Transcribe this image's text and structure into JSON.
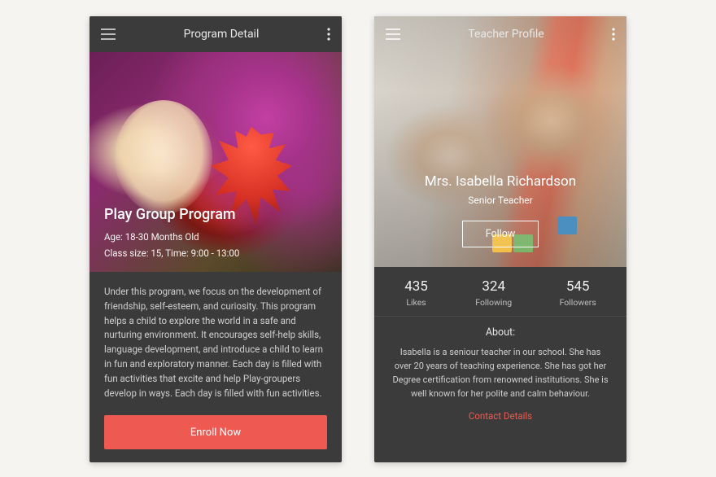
{
  "colors": {
    "card_bg": "#3b3b3b",
    "accent": "#ee5a52",
    "text_light": "#cfcfcf"
  },
  "screen1": {
    "appbar": {
      "title": "Program Detail"
    },
    "hero": {
      "title": "Play Group Program",
      "age_line": "Age: 18-30 Months Old",
      "class_line": "Class size: 15, Time: 9:00 - 13:00"
    },
    "body": "Under this program, we focus on the development of friendship, self-esteem, and curiosity. This program helps a child to explore the world in a safe and nurturing environment. It encourages self-help skills, language development, and introduce a child to learn in fun and exploratory manner. Each day is filled with fun activities that excite and help Play-groupers develop in ways. Each day is filled with fun activities.",
    "cta": "Enroll Now"
  },
  "screen2": {
    "appbar": {
      "title": "Teacher Profile"
    },
    "hero": {
      "name": "Mrs. Isabella Richardson",
      "role": "Senior Teacher",
      "follow": "Follow"
    },
    "stats": [
      {
        "num": "435",
        "label": "Likes"
      },
      {
        "num": "324",
        "label": "Following"
      },
      {
        "num": "545",
        "label": "Followers"
      }
    ],
    "about": {
      "heading": "About:",
      "text": "Isabella is a seniour teacher in our school. She has over 20 years of teaching experience. She has got her Degree certification from renowned institutions. She is well known for her polite and calm behaviour.",
      "contact": "Contact Details"
    }
  }
}
